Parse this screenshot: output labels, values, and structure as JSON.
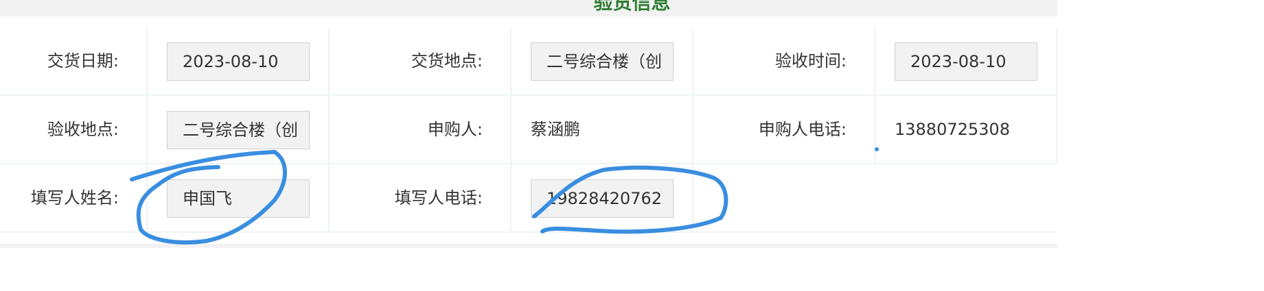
{
  "header": {
    "title": "验货信息"
  },
  "fields": {
    "delivery_date": {
      "label": "交货日期:",
      "value": "2023-08-10"
    },
    "delivery_place": {
      "label": "交货地点:",
      "value": "二号综合楼（创"
    },
    "acceptance_time": {
      "label": "验收时间:",
      "value": "2023-08-10"
    },
    "acceptance_place": {
      "label": "验收地点:",
      "value": "二号综合楼（创"
    },
    "purchaser": {
      "label": "申购人:",
      "value": "蔡涵鹏"
    },
    "purchaser_phone": {
      "label": "申购人电话:",
      "value": "13880725308"
    },
    "filler_name": {
      "label": "填写人姓名:",
      "value": "申国飞"
    },
    "filler_phone": {
      "label": "填写人电话:",
      "value": "19828420762"
    }
  },
  "annotations": {
    "ink_color": "#3a8ee0"
  }
}
